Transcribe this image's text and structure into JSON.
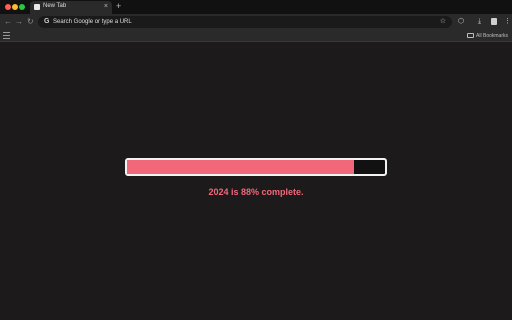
{
  "browser": {
    "tab": {
      "title": "New Tab"
    },
    "new_tab_glyph": "+",
    "tab_close_glyph": "×",
    "omnibox": {
      "placeholder": "Search Google or type a URL"
    },
    "bookmarks_bar": {
      "all_bookmarks_label": "All Bookmarks"
    }
  },
  "page": {
    "progress_fraction": 0.88,
    "caption": "2024 is 88% complete.",
    "accent_color": "#f0687a",
    "bar_border_color": "#f3f3f3"
  }
}
